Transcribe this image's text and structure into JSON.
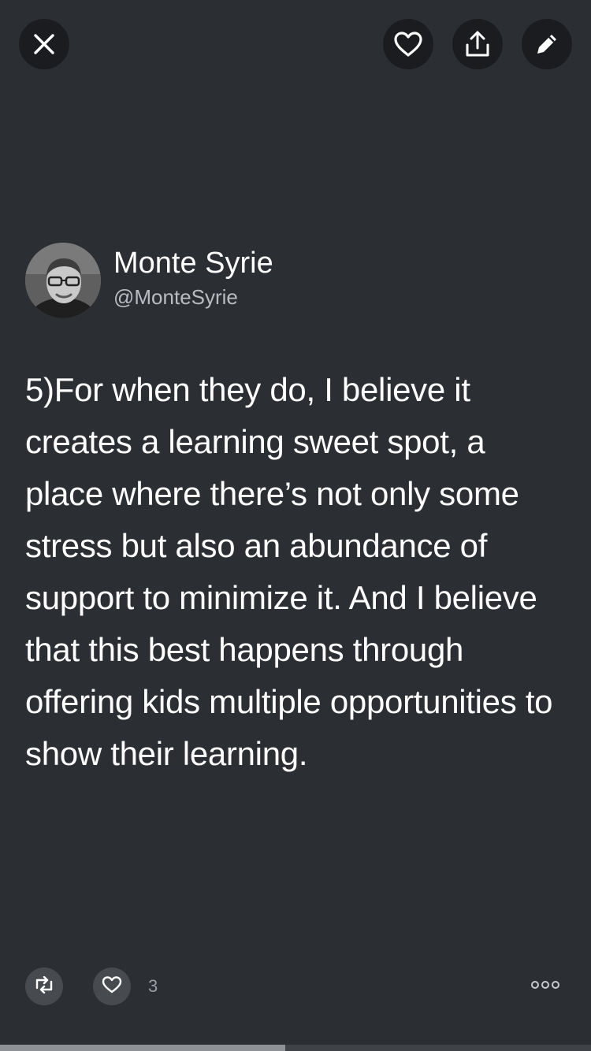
{
  "icons": {
    "close": "close-icon",
    "like": "heart-icon",
    "share": "share-icon",
    "edit": "pencil-icon",
    "retweet": "retweet-icon",
    "more": "more-icon"
  },
  "author": {
    "name": "Monte Syrie",
    "handle": "@MonteSyrie"
  },
  "tweet": {
    "text": "5)For when they do, I believe it creates a learning sweet spot, a place where there’s not only some stress but also an abundance of support to minimize it. And I believe that this best happens through offering kids multiple opportunities to show their learning."
  },
  "stats": {
    "like_count": "3"
  },
  "progress": {
    "fraction": 0.483
  },
  "colors": {
    "background": "#2b2e33",
    "button_dark": "#1a1c1f",
    "button_muted": "#474a4f",
    "handle_text": "#b9bcc1",
    "progress_fill": "#8e9196"
  }
}
